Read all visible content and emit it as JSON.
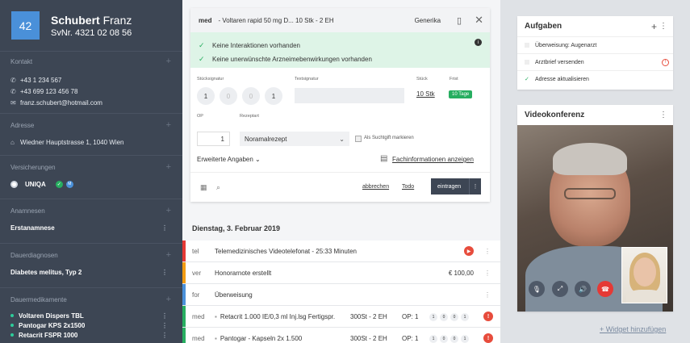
{
  "patient": {
    "number": "42",
    "last_name": "Schubert",
    "first_name": "Franz",
    "svnr": "SvNr. 4321 02 08 56"
  },
  "sidebar": {
    "kontakt": {
      "title": "Kontakt",
      "phone1": "+43 1 234 567",
      "phone2": "+43 699 123 456 78",
      "email": "franz.schubert@hotmail.com"
    },
    "adresse": {
      "title": "Adresse",
      "value": "Wiedner Hauptstrasse 1, 1040 Wien"
    },
    "versicherungen": {
      "title": "Versicherungen",
      "value": "UNIQA",
      "badge": "M"
    },
    "anamnesen": {
      "title": "Anamnesen",
      "value": "Erstanamnese"
    },
    "dauerdiagnosen": {
      "title": "Dauerdiagnosen",
      "value": "Diabetes melitus, Typ 2"
    },
    "dauermedikamente": {
      "title": "Dauermedikamente",
      "items": [
        "Voltaren Dispers TBL",
        "Pantogar KPS 2x1500",
        "Retacrit FSPR 1000"
      ]
    }
  },
  "card": {
    "tag": "med",
    "title": "- Voltaren rapid 50 mg D... 10 Stk - 2 EH",
    "generika": "Generika",
    "alerts": [
      "Keine Interaktionen vorhanden",
      "Keine unerwünschte Arzneimebenwirkungen vorhanden"
    ],
    "labels": {
      "stuecksignatur": "Stücksignatur",
      "textsignatur": "Textsignatur",
      "stueck": "Stück",
      "frist": "Frist",
      "op": "OP",
      "rezeptart": "Rezeptart"
    },
    "signatur": [
      "1",
      "0",
      "0",
      "1"
    ],
    "stueck_value": "10 Stk",
    "frist_value": "10 Tage",
    "op_value": "1",
    "rezeptart_value": "Noramalrezept",
    "suchtgift_label": "Als Suchtgift markieren",
    "erweitert": "Erweiterte Angaben",
    "fachinfo": "Fachinformationen anzeigen",
    "abbrechen": "abbrechen",
    "todo": "Todo",
    "eintragen": "eintragen"
  },
  "timeline": {
    "date": "Dienstag, 3. Februar 2019",
    "entries": [
      {
        "type": "tel",
        "text": "Telemedizinisches Videotelefonat - 25:33 Minuten",
        "color": "#e53935"
      },
      {
        "type": "ver",
        "text": "Honorarnote erstellt",
        "amount": "€ 100,00",
        "color": "#f39c12"
      },
      {
        "type": "for",
        "text": "Überweisung",
        "color": "#4a90d9"
      },
      {
        "type": "med",
        "text": "Retacrit 1.000 IE/0,3 ml Inj.lsg Fertigspr.",
        "qty": "300St - 2 EH",
        "op": "OP: 1",
        "sig": [
          "1",
          "0",
          "0",
          "1"
        ],
        "color": "#27ae60"
      },
      {
        "type": "med",
        "text": "Pantogar - Kapseln 2x 1.500",
        "qty": "300St - 2 EH",
        "op": "OP: 1",
        "sig": [
          "1",
          "0",
          "0",
          "1"
        ],
        "color": "#27ae60"
      }
    ]
  },
  "aufgaben": {
    "title": "Aufgaben",
    "tasks": [
      "Überweisung: Augenarzt",
      "Arztbrief versenden",
      "Adresse aktualisieren"
    ]
  },
  "video": {
    "title": "Videokonferenz"
  },
  "add_widget": "+ Widget hinzufügen"
}
